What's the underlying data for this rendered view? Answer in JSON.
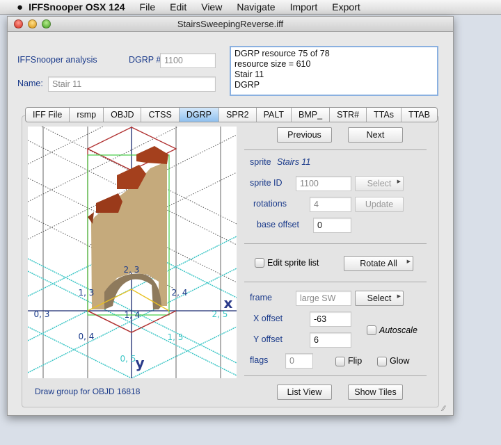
{
  "menubar": {
    "app": "IFFSnooper OSX 124",
    "items": [
      "File",
      "Edit",
      "View",
      "Navigate",
      "Import",
      "Export"
    ]
  },
  "window": {
    "title": "StairsSweepingReverse.iff"
  },
  "header": {
    "analysis_label": "IFFSnooper analysis",
    "dgrp_label": "DGRP #",
    "dgrp_value": "1100",
    "name_label": "Name:",
    "name_value": "Stair 11",
    "info_lines": [
      "DGRP resource 75 of 78",
      "resource size =  610",
      "Stair 11",
      "DGRP"
    ]
  },
  "tabs": [
    "IFF File",
    "rsmp",
    "OBJD",
    "CTSS",
    "DGRP",
    "SPR2",
    "PALT",
    "BMP_",
    "STR#",
    "TTAs",
    "TTAB"
  ],
  "active_tab": "DGRP",
  "canvas": {
    "labels": [
      "2, 3",
      "1, 3",
      "2, 4",
      "0, 3",
      "1, 4",
      "2, 5",
      "0, 4",
      "1, 5",
      "0, 5"
    ],
    "axis_x": "x",
    "axis_y": "y"
  },
  "footer_text": "Draw group for OBJD 16818",
  "panel": {
    "previous": "Previous",
    "next": "Next",
    "sprite_label": "sprite",
    "sprite_name": "Stairs 11",
    "sprite_id_label": "sprite ID",
    "sprite_id": "1100",
    "select": "Select",
    "rotations_label": "rotations",
    "rotations": "4",
    "update": "Update",
    "base_offset_label": "base offset",
    "base_offset": "0",
    "edit_sprite_list": "Edit sprite list",
    "rotate_all": "Rotate All",
    "frame_label": "frame",
    "frame_value": "large SW",
    "frame_select": "Select",
    "x_offset_label": "X offset",
    "x_offset": "-63",
    "y_offset_label": "Y offset",
    "y_offset": "6",
    "autoscale": "Autoscale",
    "flags_label": "flags",
    "flags": "0",
    "flip": "Flip",
    "glow": "Glow",
    "list_view": "List View",
    "show_tiles": "Show Tiles"
  },
  "colors": {
    "tab_active": "#8fc0ee",
    "label_blue": "#1a3a8a",
    "grid_cyan": "#3cc6c6",
    "bbox_red": "#b03030",
    "bbox_green": "#44cc44"
  }
}
